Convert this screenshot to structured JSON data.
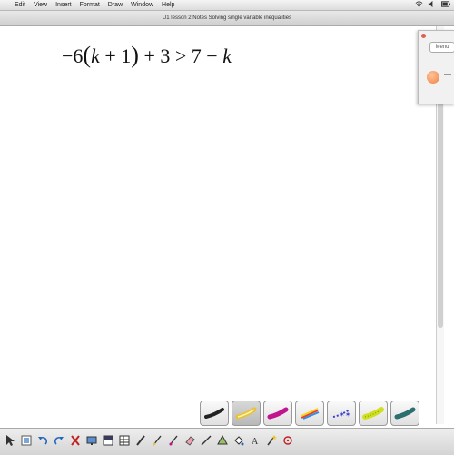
{
  "menubar": {
    "apple_glyph": "",
    "items": [
      "Edit",
      "View",
      "Insert",
      "Format",
      "Draw",
      "Window",
      "Help"
    ]
  },
  "window": {
    "title": "U1 lesson 2 Notes Solving single variable inequalities"
  },
  "canvas": {
    "equation": {
      "coef": "−6",
      "open": "(",
      "var1": "k",
      "plus1": " + 1",
      "close": ")",
      "rest": " + 3 > 7 − ",
      "var2": "k"
    }
  },
  "side_panel": {
    "menu_label": "Menu",
    "swatch_color": "#f4844a"
  },
  "pen_tray": {
    "pens": [
      {
        "name": "calligraphy-pen-icon",
        "color": "#222222"
      },
      {
        "name": "highlighter-pen-icon",
        "color": "#e8c23a"
      },
      {
        "name": "magenta-pen-icon",
        "color": "#c0158f"
      },
      {
        "name": "rainbow-pen-icon",
        "color": "#e83f2f"
      },
      {
        "name": "star-pen-icon",
        "color": "#3a3fcf"
      },
      {
        "name": "texture-pen-icon",
        "color": "#cfe020"
      },
      {
        "name": "teal-pen-icon",
        "color": "#2c6f6f"
      }
    ],
    "selected_index": 1
  },
  "toolbar": {
    "tools": [
      "select-arrow",
      "page-sorter",
      "undo",
      "redo",
      "delete",
      "screen-display",
      "screen-shade",
      "table",
      "pen",
      "highlighter",
      "eraser",
      "line",
      "shape",
      "fill",
      "text",
      "magic-pen",
      "pointer"
    ]
  }
}
